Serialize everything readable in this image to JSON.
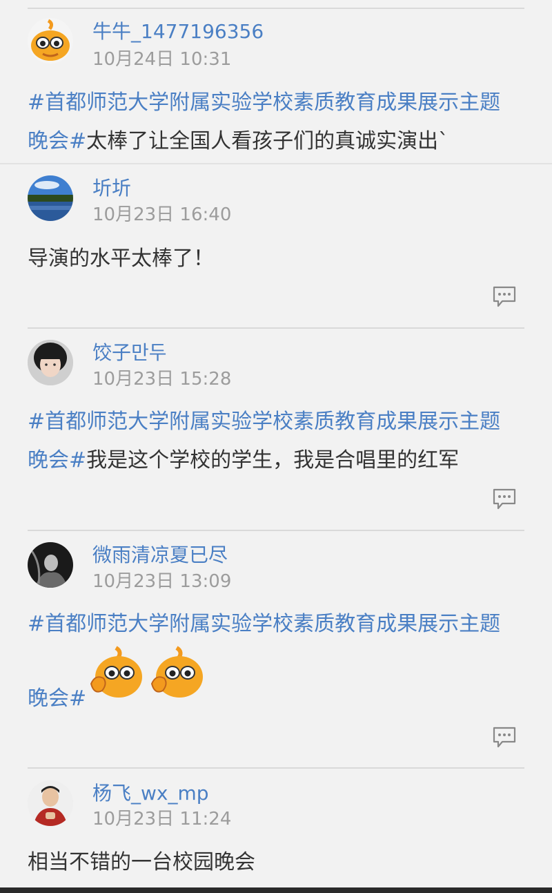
{
  "comments": [
    {
      "user": "牛牛_1477196356",
      "time": "10月24日 10:31",
      "line1_tag": "#首都师范大学附属实验学校素质教育成果展示主题",
      "line2_tag": "晚会#",
      "line2_text": "太棒了让全国人看孩子们的真诚实演出`",
      "avatar_icon": "orange-mascot-avatar"
    },
    {
      "user": "圻圻",
      "time": "10月23日 16:40",
      "text": "导演的水平太棒了！",
      "avatar_icon": "landscape-photo-avatar"
    },
    {
      "user": "饺子만두",
      "time": "10月23日 15:28",
      "line1_tag": "#首都师范大学附属实验学校素质教育成果展示主题",
      "line2_tag": "晚会#",
      "line2_text": "我是这个学校的学生，我是合唱里的红军",
      "avatar_icon": "girl-portrait-avatar"
    },
    {
      "user": "微雨清凉夏已尽",
      "time": "10月23日 13:09",
      "line1_tag": "#首都师范大学附属实验学校素质教育成果展示主题",
      "line2_tag": "晚会#",
      "emojis": [
        "thumbs-up-mascot-emoji",
        "thumbs-up-mascot-emoji"
      ],
      "avatar_icon": "dark-photo-avatar"
    },
    {
      "user": "杨飞_wx_mp",
      "time": "10月23日 11:24",
      "text": "相当不错的一台校园晚会",
      "avatar_icon": "boy-portrait-avatar"
    }
  ],
  "colors": {
    "link": "#4a7fc4",
    "time": "#9c9c9c",
    "background": "#f2f2f2"
  }
}
